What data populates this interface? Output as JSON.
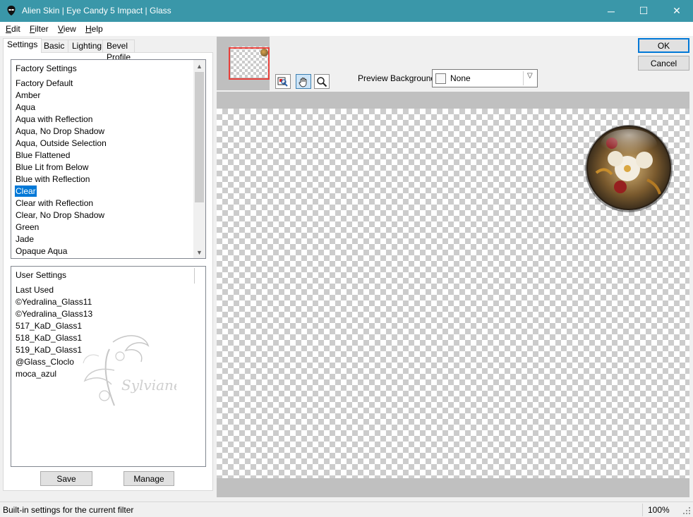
{
  "window": {
    "title": "Alien Skin | Eye Candy 5 Impact | Glass",
    "minimize_glyph": "─",
    "maximize_glyph": "☐",
    "close_glyph": "✕",
    "accent_color": "#3a97a9"
  },
  "menu": {
    "items": [
      {
        "label": "Edit",
        "accel": "E",
        "rest": "dit"
      },
      {
        "label": "Filter",
        "accel": "F",
        "rest": "ilter"
      },
      {
        "label": "View",
        "accel": "V",
        "rest": "iew"
      },
      {
        "label": "Help",
        "accel": "H",
        "rest": "elp"
      }
    ]
  },
  "tabs": [
    "Settings",
    "Basic",
    "Lighting",
    "Bevel Profile"
  ],
  "active_tab": "Settings",
  "factory_settings": {
    "header": "Factory Settings",
    "items": [
      "Factory Default",
      "Amber",
      "Aqua",
      "Aqua with Reflection",
      "Aqua, No Drop Shadow",
      "Aqua, Outside Selection",
      "Blue Flattened",
      "Blue Lit from Below",
      "Blue with Reflection",
      "Clear",
      "Clear with Reflection",
      "Clear, No Drop Shadow",
      "Green",
      "Jade",
      "Opaque Aqua"
    ],
    "selected": "Clear"
  },
  "user_settings": {
    "header": "User Settings",
    "items": [
      "Last Used",
      "©Yedralina_Glass11",
      "©Yedralina_Glass13",
      "517_KaD_Glass1",
      "518_KaD_Glass1",
      "519_KaD_Glass1",
      "@Glass_Cloclo",
      "moca_azul"
    ],
    "watermark": "Sylviane"
  },
  "buttons": {
    "save": "Save",
    "manage": "Manage",
    "ok": "OK",
    "cancel": "Cancel"
  },
  "preview": {
    "background_label": "Preview Background:",
    "background_value": "None",
    "tools": [
      "navigator-tool-icon",
      "hand-icon",
      "zoom-icon"
    ],
    "active_tool": "hand-icon"
  },
  "status": {
    "text": "Built-in settings for the current filter",
    "zoom": "100%"
  }
}
